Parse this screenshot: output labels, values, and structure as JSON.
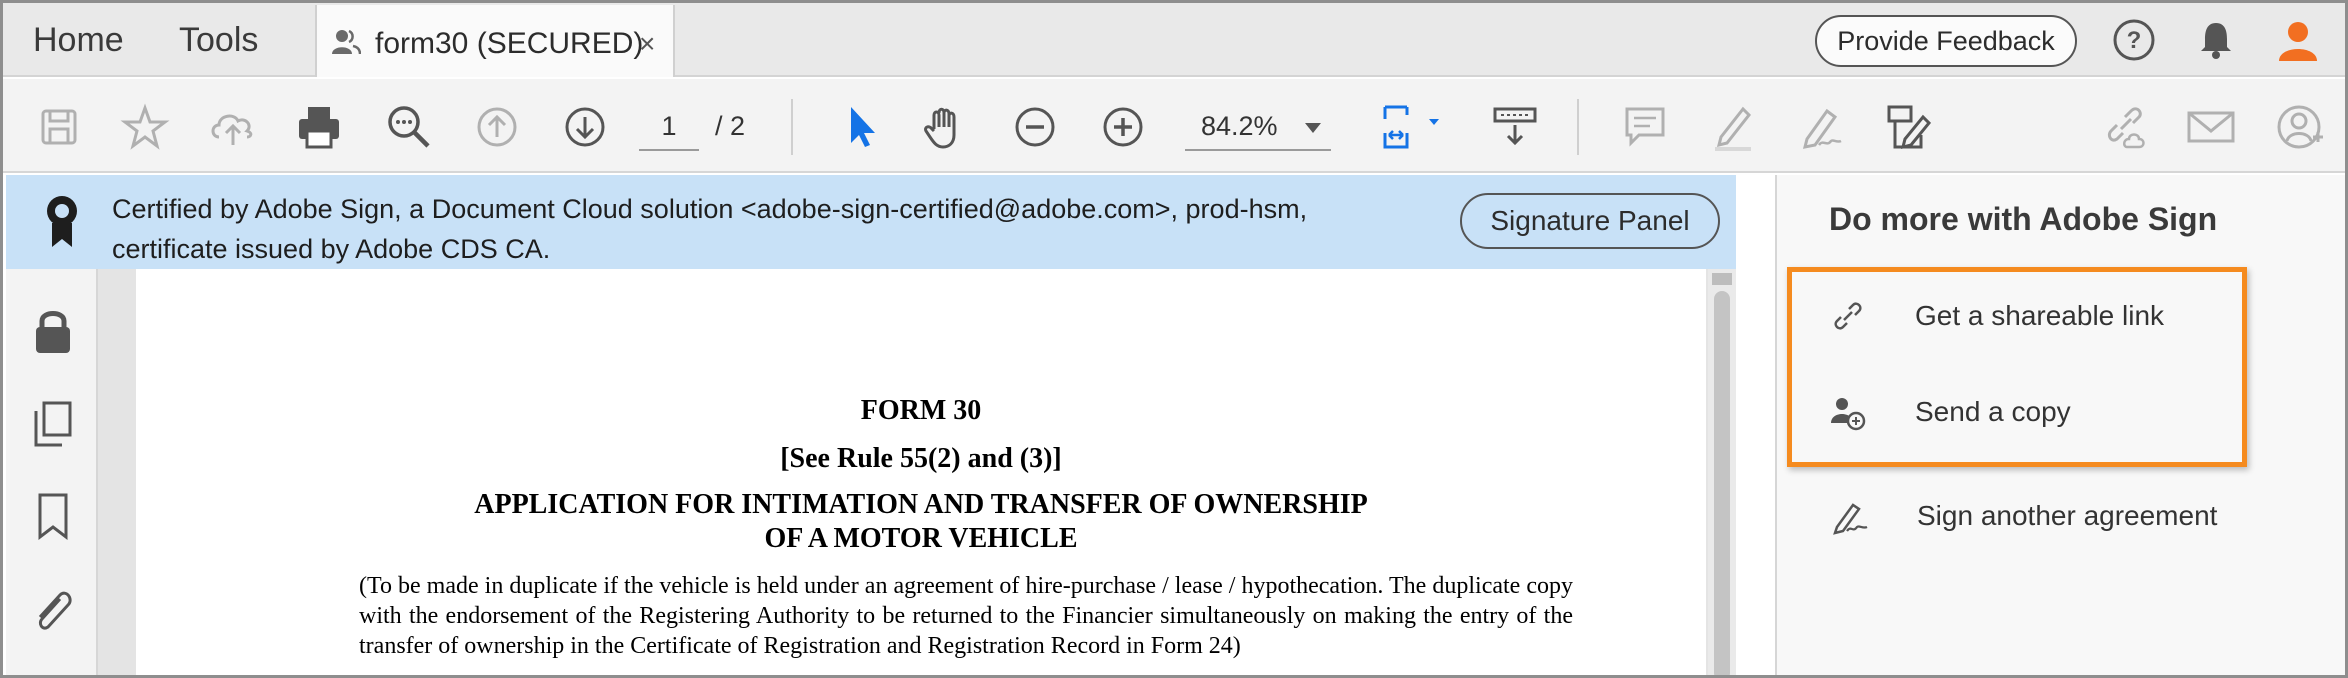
{
  "tabs": {
    "home": "Home",
    "tools": "Tools",
    "document": {
      "title": "form30 (SECURED)",
      "close": "×"
    }
  },
  "header": {
    "feedback_label": "Provide Feedback",
    "icons": [
      "help-icon",
      "notification-bell-icon",
      "user-avatar-icon"
    ]
  },
  "toolbar": {
    "icons": [
      "save-icon",
      "bookmark-star-icon",
      "upload-cloud-icon",
      "print-icon",
      "search-icon",
      "page-up-icon",
      "page-down-icon",
      "select-arrow-icon",
      "hand-tool-icon",
      "zoom-out-icon",
      "zoom-in-icon",
      "fit-page-icon",
      "scroll-mode-icon",
      "comment-icon",
      "highlight-icon",
      "fill-sign-icon",
      "edit-icon",
      "link-icon",
      "email-icon",
      "add-user-icon"
    ],
    "page_current": "1",
    "page_total": "/ 2",
    "zoom": "84.2%"
  },
  "cert_banner": {
    "text_line1": "Certified by Adobe Sign, a Document Cloud solution <adobe-sign-certified@adobe.com>, prod-hsm,",
    "text_line2": "certificate issued by Adobe CDS CA.",
    "button_label": "Signature Panel"
  },
  "left_rail": {
    "icons": [
      "lock-icon",
      "pages-icon",
      "bookmark-icon",
      "attachment-icon"
    ]
  },
  "document": {
    "form_title": "FORM 30",
    "rule_ref": "[See Rule 55(2) and (3)]",
    "app_title_line1": "APPLICATION FOR INTIMATION AND TRANSFER OF OWNERSHIP",
    "app_title_line2": "OF A MOTOR VEHICLE",
    "note": "(To be made in duplicate if the vehicle is held under an agreement of hire-purchase / lease / hypothecation. The duplicate copy with the endorsement of the Registering Authority to be returned to the Financier simultaneously on making the entry of the transfer of ownership in the Certificate of Registration and Registration Record in Form 24)"
  },
  "right_panel": {
    "heading": "Do more with Adobe Sign",
    "items": [
      {
        "label": "Get a shareable link",
        "icon": "link-icon"
      },
      {
        "label": "Send a copy",
        "icon": "send-user-icon"
      },
      {
        "label": "Sign another agreement",
        "icon": "sign-pen-icon"
      }
    ]
  },
  "colors": {
    "accent_blue": "#1473e6",
    "banner_bg": "#c8e1f7",
    "highlight_orange": "#f58b1f",
    "avatar_orange": "#f26f21"
  }
}
